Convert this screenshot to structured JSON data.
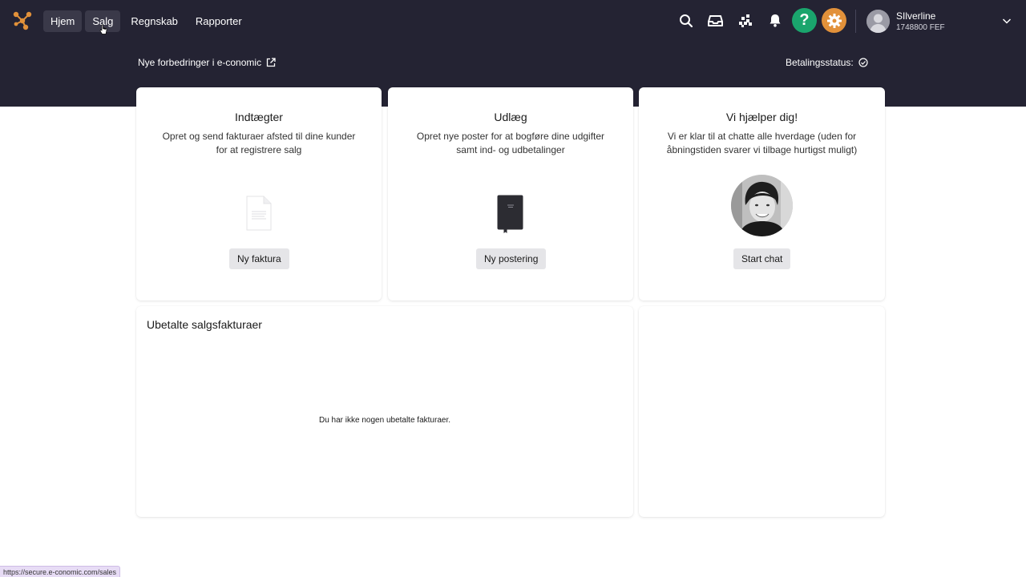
{
  "nav": {
    "items": [
      {
        "label": "Hjem"
      },
      {
        "label": "Salg"
      },
      {
        "label": "Regnskab"
      },
      {
        "label": "Rapporter"
      }
    ]
  },
  "topbar_icons": [
    "search-icon",
    "inbox-icon",
    "apps-grid-icon",
    "bell-icon",
    "help-icon",
    "gear-icon"
  ],
  "help_symbol": "?",
  "user": {
    "name": "SIlverline",
    "id": "1748800 FEF"
  },
  "subbar": {
    "news_label": "Nye forbedringer i e-conomic",
    "payment_status_label": "Betalingsstatus:"
  },
  "cards": {
    "income": {
      "title": "Indtægter",
      "description": "Opret og send fakturaer afsted til dine kunder for at registrere salg",
      "button": "Ny faktura"
    },
    "expenses": {
      "title": "Udlæg",
      "description": "Opret nye poster for at bogføre dine udgifter samt ind- og udbetalinger",
      "button": "Ny postering"
    },
    "help": {
      "title": "Vi hjælper dig!",
      "description": "Vi er klar til at chatte alle hverdage (uden for åbningstiden svarer vi tilbage hurtigst muligt)",
      "button": "Start chat"
    }
  },
  "unpaid": {
    "title": "Ubetalte salgsfakturaer",
    "empty_message": "Du har ikke nogen ubetalte fakturaer."
  },
  "status_bar_url": "https://secure.e-conomic.com/sales",
  "colors": {
    "topbar": "#242333",
    "help_green": "#1aa56d",
    "settings_orange": "#e2913a",
    "logo_orange": "#e2913a"
  }
}
